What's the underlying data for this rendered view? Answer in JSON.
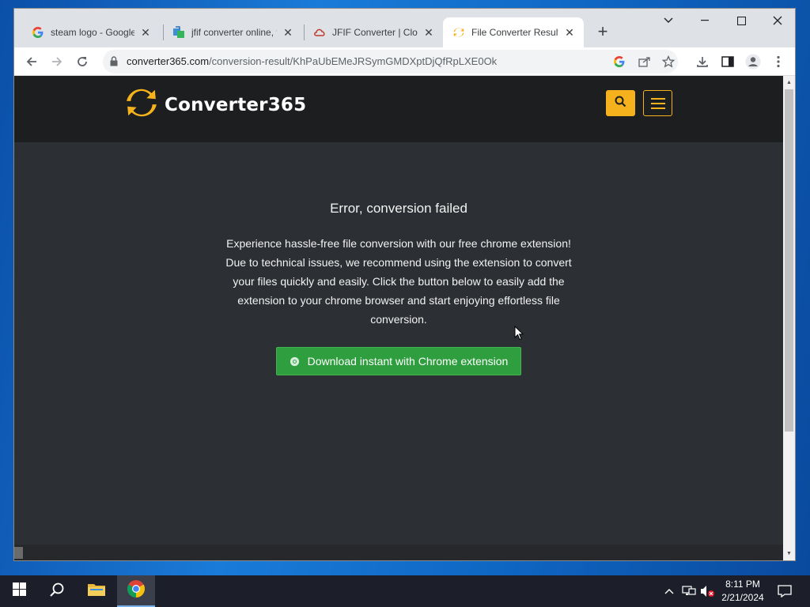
{
  "browser": {
    "tabs": [
      {
        "title": "steam logo - Google",
        "favicon": "google-icon",
        "active": false
      },
      {
        "title": "jfif converter online, f",
        "favicon": "convert-favicon",
        "active": false
      },
      {
        "title": "JFIF Converter | Clou",
        "favicon": "cloud-favicon",
        "active": false
      },
      {
        "title": "File Converter Result",
        "favicon": "converter365-favicon",
        "active": true
      }
    ],
    "url_host": "converter365.com",
    "url_path": "/conversion-result/KhPaUbEMeJRSymGMDXptDjQfRpLXE0Ok"
  },
  "site": {
    "brand": "Converter365",
    "accent_color": "#f5b21c",
    "header_bg": "#1d1e20",
    "page_bg": "#2c2f33"
  },
  "main": {
    "error_title": "Error, conversion failed",
    "error_text": "Experience hassle-free file conversion with our free chrome extension! Due to technical issues, we recommend using the extension to convert your files quickly and easily. Click the button below to easily add the extension to your chrome browser and start enjoying effortless file conversion.",
    "download_button": "Download instant with Chrome extension",
    "download_button_color": "#2e9e3e"
  },
  "taskbar": {
    "time": "8:11 PM",
    "date": "2/21/2024"
  }
}
